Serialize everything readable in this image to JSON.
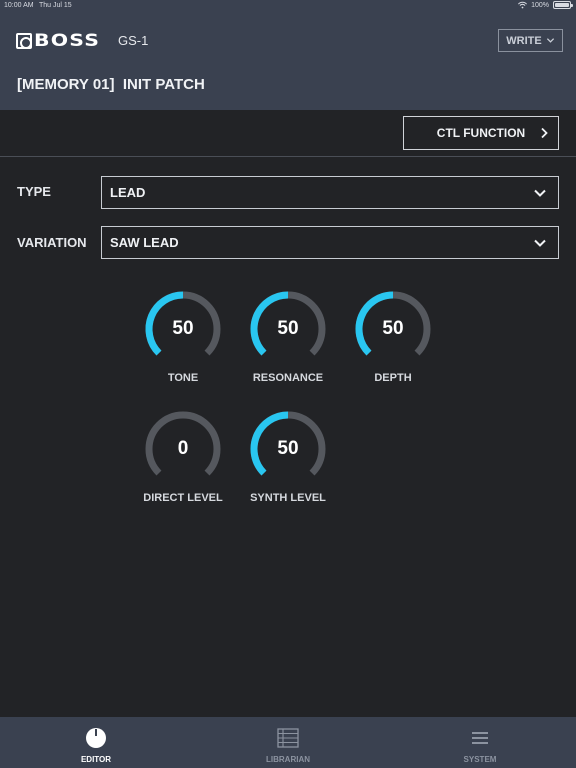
{
  "status_bar": {
    "time": "10:00 AM",
    "date": "Thu Jul 15",
    "battery": "100%"
  },
  "header": {
    "logo": "BOSS",
    "device": "GS-1",
    "write_label": "WRITE",
    "patch_title": "[MEMORY 01]  INIT PATCH"
  },
  "ctl_function_label": "CTL FUNCTION",
  "type": {
    "label": "TYPE",
    "value": "LEAD"
  },
  "variation": {
    "label": "VARIATION",
    "value": "SAW LEAD"
  },
  "knobs": [
    {
      "label": "TONE",
      "value": "50",
      "level": 0.5
    },
    {
      "label": "RESONANCE",
      "value": "50",
      "level": 0.5
    },
    {
      "label": "DEPTH",
      "value": "50",
      "level": 0.5
    },
    {
      "label": "DIRECT LEVEL",
      "value": "0",
      "level": 0
    },
    {
      "label": "SYNTH LEVEL",
      "value": "50",
      "level": 0.5
    }
  ],
  "tabs": [
    {
      "label": "EDITOR",
      "icon": "knob-icon",
      "active": true
    },
    {
      "label": "LIBRARIAN",
      "icon": "list-grid-icon",
      "active": false
    },
    {
      "label": "SYSTEM",
      "icon": "menu-icon",
      "active": false
    }
  ],
  "colors": {
    "accent": "#29c6f0",
    "track": "#55585e",
    "header_bg": "#3a4150",
    "body_bg": "#222326"
  }
}
